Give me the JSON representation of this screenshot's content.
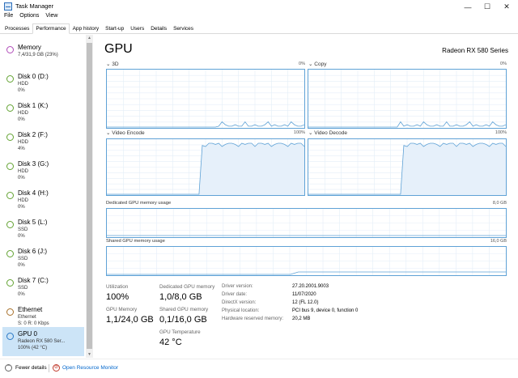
{
  "window": {
    "title": "Task Manager",
    "minimize": "—",
    "maximize": "☐",
    "close": "✕"
  },
  "menu": [
    "File",
    "Options",
    "View"
  ],
  "tabs": [
    "Processes",
    "Performance",
    "App history",
    "Start-up",
    "Users",
    "Details",
    "Services"
  ],
  "active_tab": "Performance",
  "sidebar": [
    {
      "name": "Memory",
      "sub1": "7,4/31,9 GB (23%)",
      "sub2": "",
      "color": "#b04ab8"
    },
    {
      "name": "Disk 0 (D:)",
      "sub1": "HDD",
      "sub2": "0%",
      "color": "#63a332"
    },
    {
      "name": "Disk 1 (K:)",
      "sub1": "HDD",
      "sub2": "0%",
      "color": "#63a332"
    },
    {
      "name": "Disk 2 (F:)",
      "sub1": "HDD",
      "sub2": "4%",
      "color": "#63a332"
    },
    {
      "name": "Disk 3 (G:)",
      "sub1": "HDD",
      "sub2": "0%",
      "color": "#63a332"
    },
    {
      "name": "Disk 4 (H:)",
      "sub1": "HDD",
      "sub2": "0%",
      "color": "#63a332"
    },
    {
      "name": "Disk 5 (L:)",
      "sub1": "SSD",
      "sub2": "0%",
      "color": "#63a332"
    },
    {
      "name": "Disk 6 (J:)",
      "sub1": "SSD",
      "sub2": "0%",
      "color": "#63a332"
    },
    {
      "name": "Disk 7 (C:)",
      "sub1": "SSD",
      "sub2": "0%",
      "color": "#63a332"
    },
    {
      "name": "Ethernet",
      "sub1": "Ethernet",
      "sub2": "S: 0 R: 0 Kbps",
      "color": "#a8702a"
    },
    {
      "name": "GPU 0",
      "sub1": "Radeon RX 580 Ser...",
      "sub2": "100% (42 °C)",
      "color": "#2a78c6"
    }
  ],
  "selected_sidebar": 10,
  "main": {
    "title": "GPU",
    "model": "Radeon RX 580 Series",
    "engines": [
      {
        "label": "3D",
        "pct": "0%",
        "level": 0.0
      },
      {
        "label": "Copy",
        "pct": "0%",
        "level": 0.0
      },
      {
        "label": "Video Encode",
        "pct": "100%",
        "level": 1.0
      },
      {
        "label": "Video Decode",
        "pct": "100%",
        "level": 1.0
      }
    ],
    "dedicated": {
      "label": "Dedicated GPU memory usage",
      "max": "8,0 GB"
    },
    "shared": {
      "label": "Shared GPU memory usage",
      "max": "16,0 GB"
    }
  },
  "stats": {
    "utilization_label": "Utilization",
    "utilization": "100%",
    "dedicated_label": "Dedicated GPU memory",
    "dedicated": "1,0/8,0 GB",
    "gpu_memory_label": "GPU Memory",
    "gpu_memory": "1,1/24,0 GB",
    "shared_label": "Shared GPU memory",
    "shared": "0,1/16,0 GB",
    "temperature_label": "GPU Temperature",
    "temperature": "42 °C"
  },
  "info": [
    {
      "label": "Driver version:",
      "value": "27.20.2001.9003"
    },
    {
      "label": "Driver date:",
      "value": "11/07/2020"
    },
    {
      "label": "DirectX version:",
      "value": "12 (FL 12.0)"
    },
    {
      "label": "Physical location:",
      "value": "PCI bus 9, device 0, function 0"
    },
    {
      "label": "Hardware reserved memory:",
      "value": "20,2 MB"
    }
  ],
  "footer": {
    "fewer_details": "Fewer details",
    "resource_monitor": "Open Resource Monitor"
  },
  "colors": {
    "graph_line": "#5fa2d6",
    "graph_fill": "#e6f0fa",
    "grid": "#e4eef8",
    "selected": "#cce4f7",
    "link": "#0066cc"
  },
  "icons": [
    "task-manager-icon",
    "minimize-icon",
    "maximize-icon",
    "close-icon",
    "fewer-details-icon",
    "resource-monitor-icon"
  ]
}
